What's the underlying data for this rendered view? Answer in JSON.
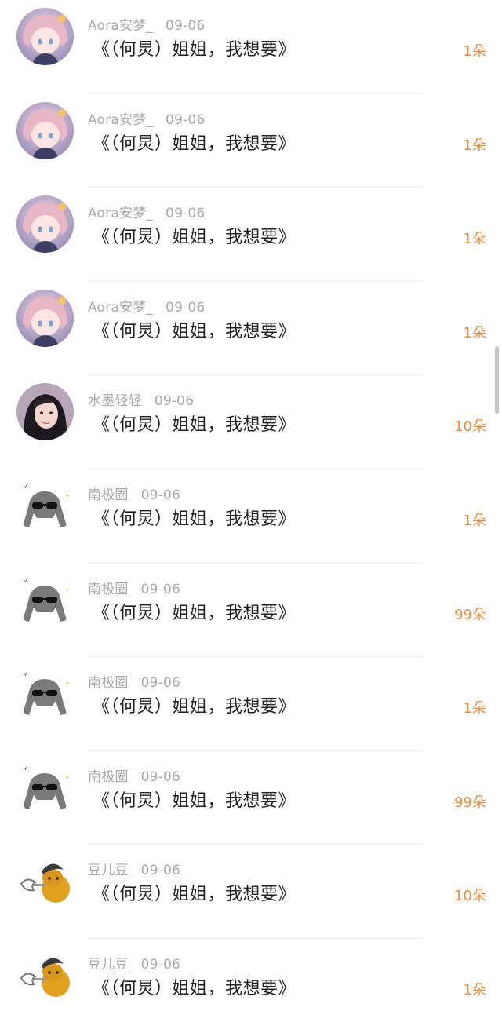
{
  "comments": [
    {
      "user": "Aora安梦_",
      "date": "09-06",
      "text": "《（何炅）姐姐，我想要》",
      "gift": "1朵",
      "avatar": "anime-girl-avatar"
    },
    {
      "user": "Aora安梦_",
      "date": "09-06",
      "text": "《（何炅）姐姐，我想要》",
      "gift": "1朵",
      "avatar": "anime-girl-avatar"
    },
    {
      "user": "Aora安梦_",
      "date": "09-06",
      "text": "《（何炅）姐姐，我想要》",
      "gift": "1朵",
      "avatar": "anime-girl-avatar"
    },
    {
      "user": "Aora安梦_",
      "date": "09-06",
      "text": "《（何炅）姐姐，我想要》",
      "gift": "1朵",
      "avatar": "anime-girl-avatar"
    },
    {
      "user": "水墨轻轻",
      "date": "09-06",
      "text": "《（何炅）姐姐，我想要》",
      "gift": "10朵",
      "avatar": "woman-portrait-avatar"
    },
    {
      "user": "南极圈",
      "date": "09-06",
      "text": "《（何炅）姐姐，我想要》",
      "gift": "1朵",
      "avatar": "sunglasses-cartoon-avatar"
    },
    {
      "user": "南极圈",
      "date": "09-06",
      "text": "《（何炅）姐姐，我想要》",
      "gift": "99朵",
      "avatar": "sunglasses-cartoon-avatar"
    },
    {
      "user": "南极圈",
      "date": "09-06",
      "text": "《（何炅）姐姐，我想要》",
      "gift": "1朵",
      "avatar": "sunglasses-cartoon-avatar"
    },
    {
      "user": "南极圈",
      "date": "09-06",
      "text": "《（何炅）姐姐，我想要》",
      "gift": "99朵",
      "avatar": "sunglasses-cartoon-avatar"
    },
    {
      "user": "豆儿豆",
      "date": "09-06",
      "text": "《（何炅）姐姐，我想要》",
      "gift": "10朵",
      "avatar": "doge-cartoon-avatar"
    },
    {
      "user": "豆儿豆",
      "date": "09-06",
      "text": "《（何炅）姐姐，我想要》",
      "gift": "1朵",
      "avatar": "doge-cartoon-avatar"
    }
  ],
  "colors": {
    "username": "#a9a9a9",
    "message": "#222222",
    "gift": "#f08a3c",
    "divider": "#f1f1f1"
  }
}
